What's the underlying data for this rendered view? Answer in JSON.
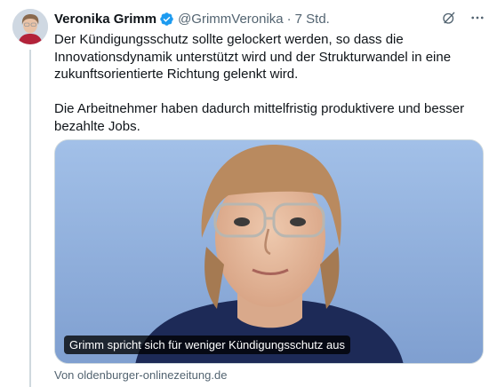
{
  "author": {
    "display_name": "Veronika Grimm",
    "handle": "@GrimmVeronika",
    "separator": "·",
    "time": "7 Std."
  },
  "tweet": {
    "paragraphs": [
      "Der Kündigungsschutz sollte gelockert werden, so dass die Innovationsdynamik unterstützt wird und der Strukturwandel in eine zukunftsorientierte Richtung gelenkt wird.",
      "Die Arbeitnehmer haben dadurch mittelfristig produktivere und besser bezahlte Jobs."
    ]
  },
  "card": {
    "caption": "Grimm spricht sich für weniger Kündigungsschutz aus",
    "source": "Von oldenburger-onlinezeitung.de"
  },
  "icons": {
    "verified": "verified-badge-icon",
    "grok": "grok-icon",
    "more": "more-icon"
  },
  "colors": {
    "verified": "#1d9bf0",
    "secondary_text": "#536471",
    "primary_text": "#0f1419"
  }
}
